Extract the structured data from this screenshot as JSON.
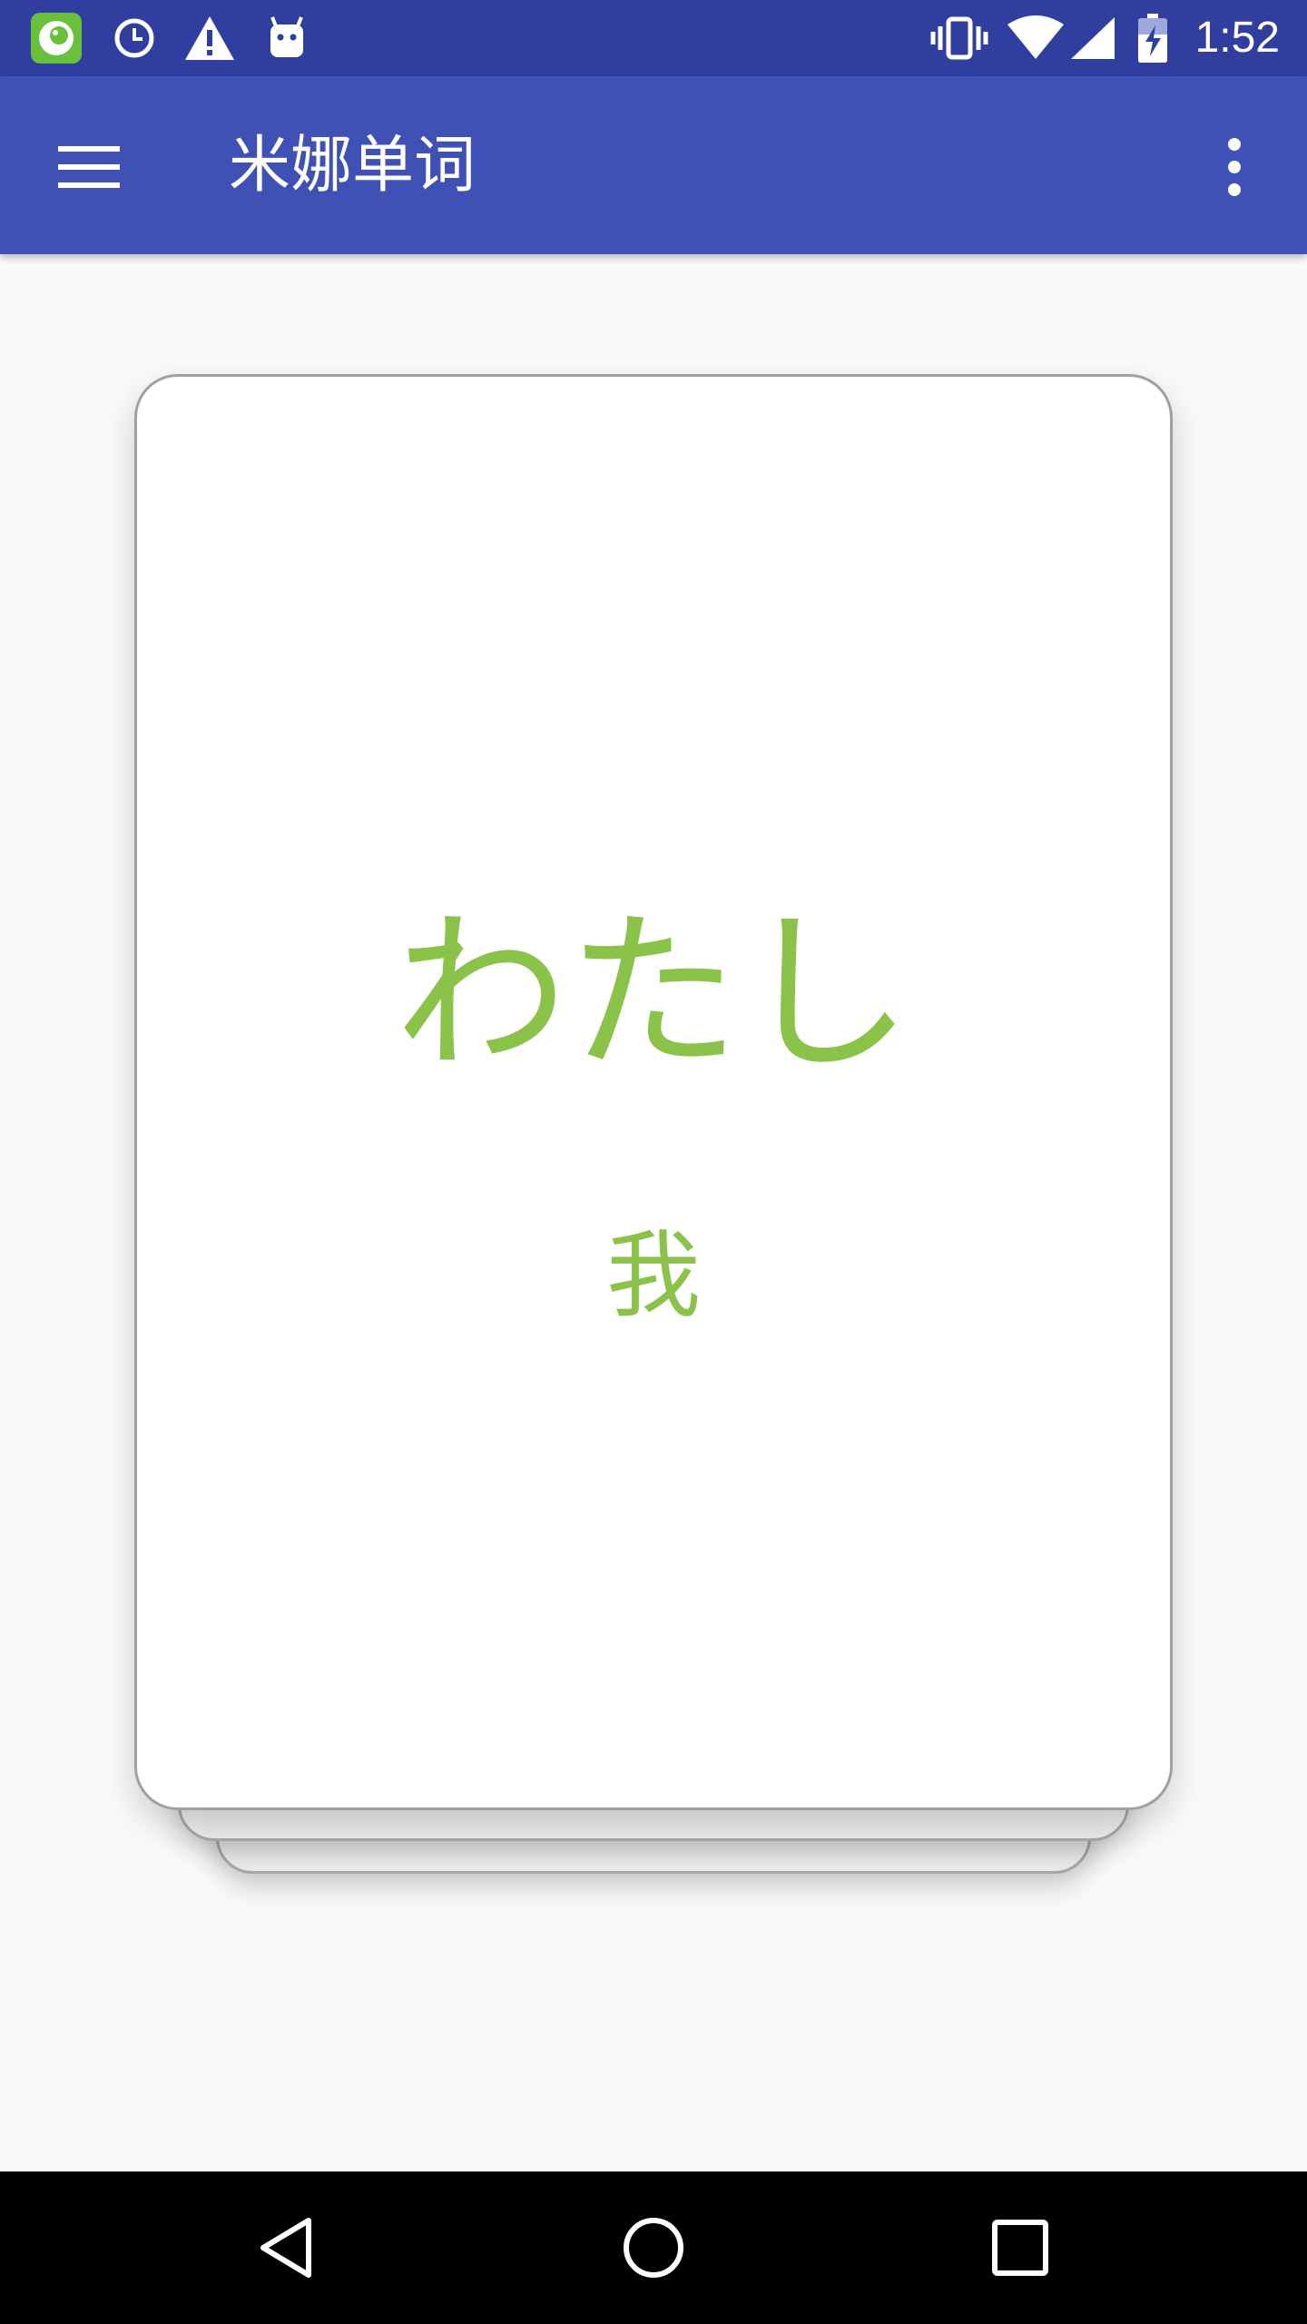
{
  "status_bar": {
    "time": "1:52",
    "left_icons": [
      "app-notification-icon",
      "clock-icon",
      "warning-icon",
      "android-icon"
    ],
    "right_icons": [
      "vibrate-icon",
      "wifi-icon",
      "signal-icon",
      "battery-charging-icon"
    ],
    "background": "#303f9f"
  },
  "app_bar": {
    "title": "米娜单词",
    "background": "#3f51b5"
  },
  "card": {
    "word": "わたし",
    "meaning": "我",
    "text_color": "#8bc34a"
  },
  "nav_bar": {
    "buttons": [
      "back-icon",
      "home-icon",
      "recents-icon"
    ]
  }
}
